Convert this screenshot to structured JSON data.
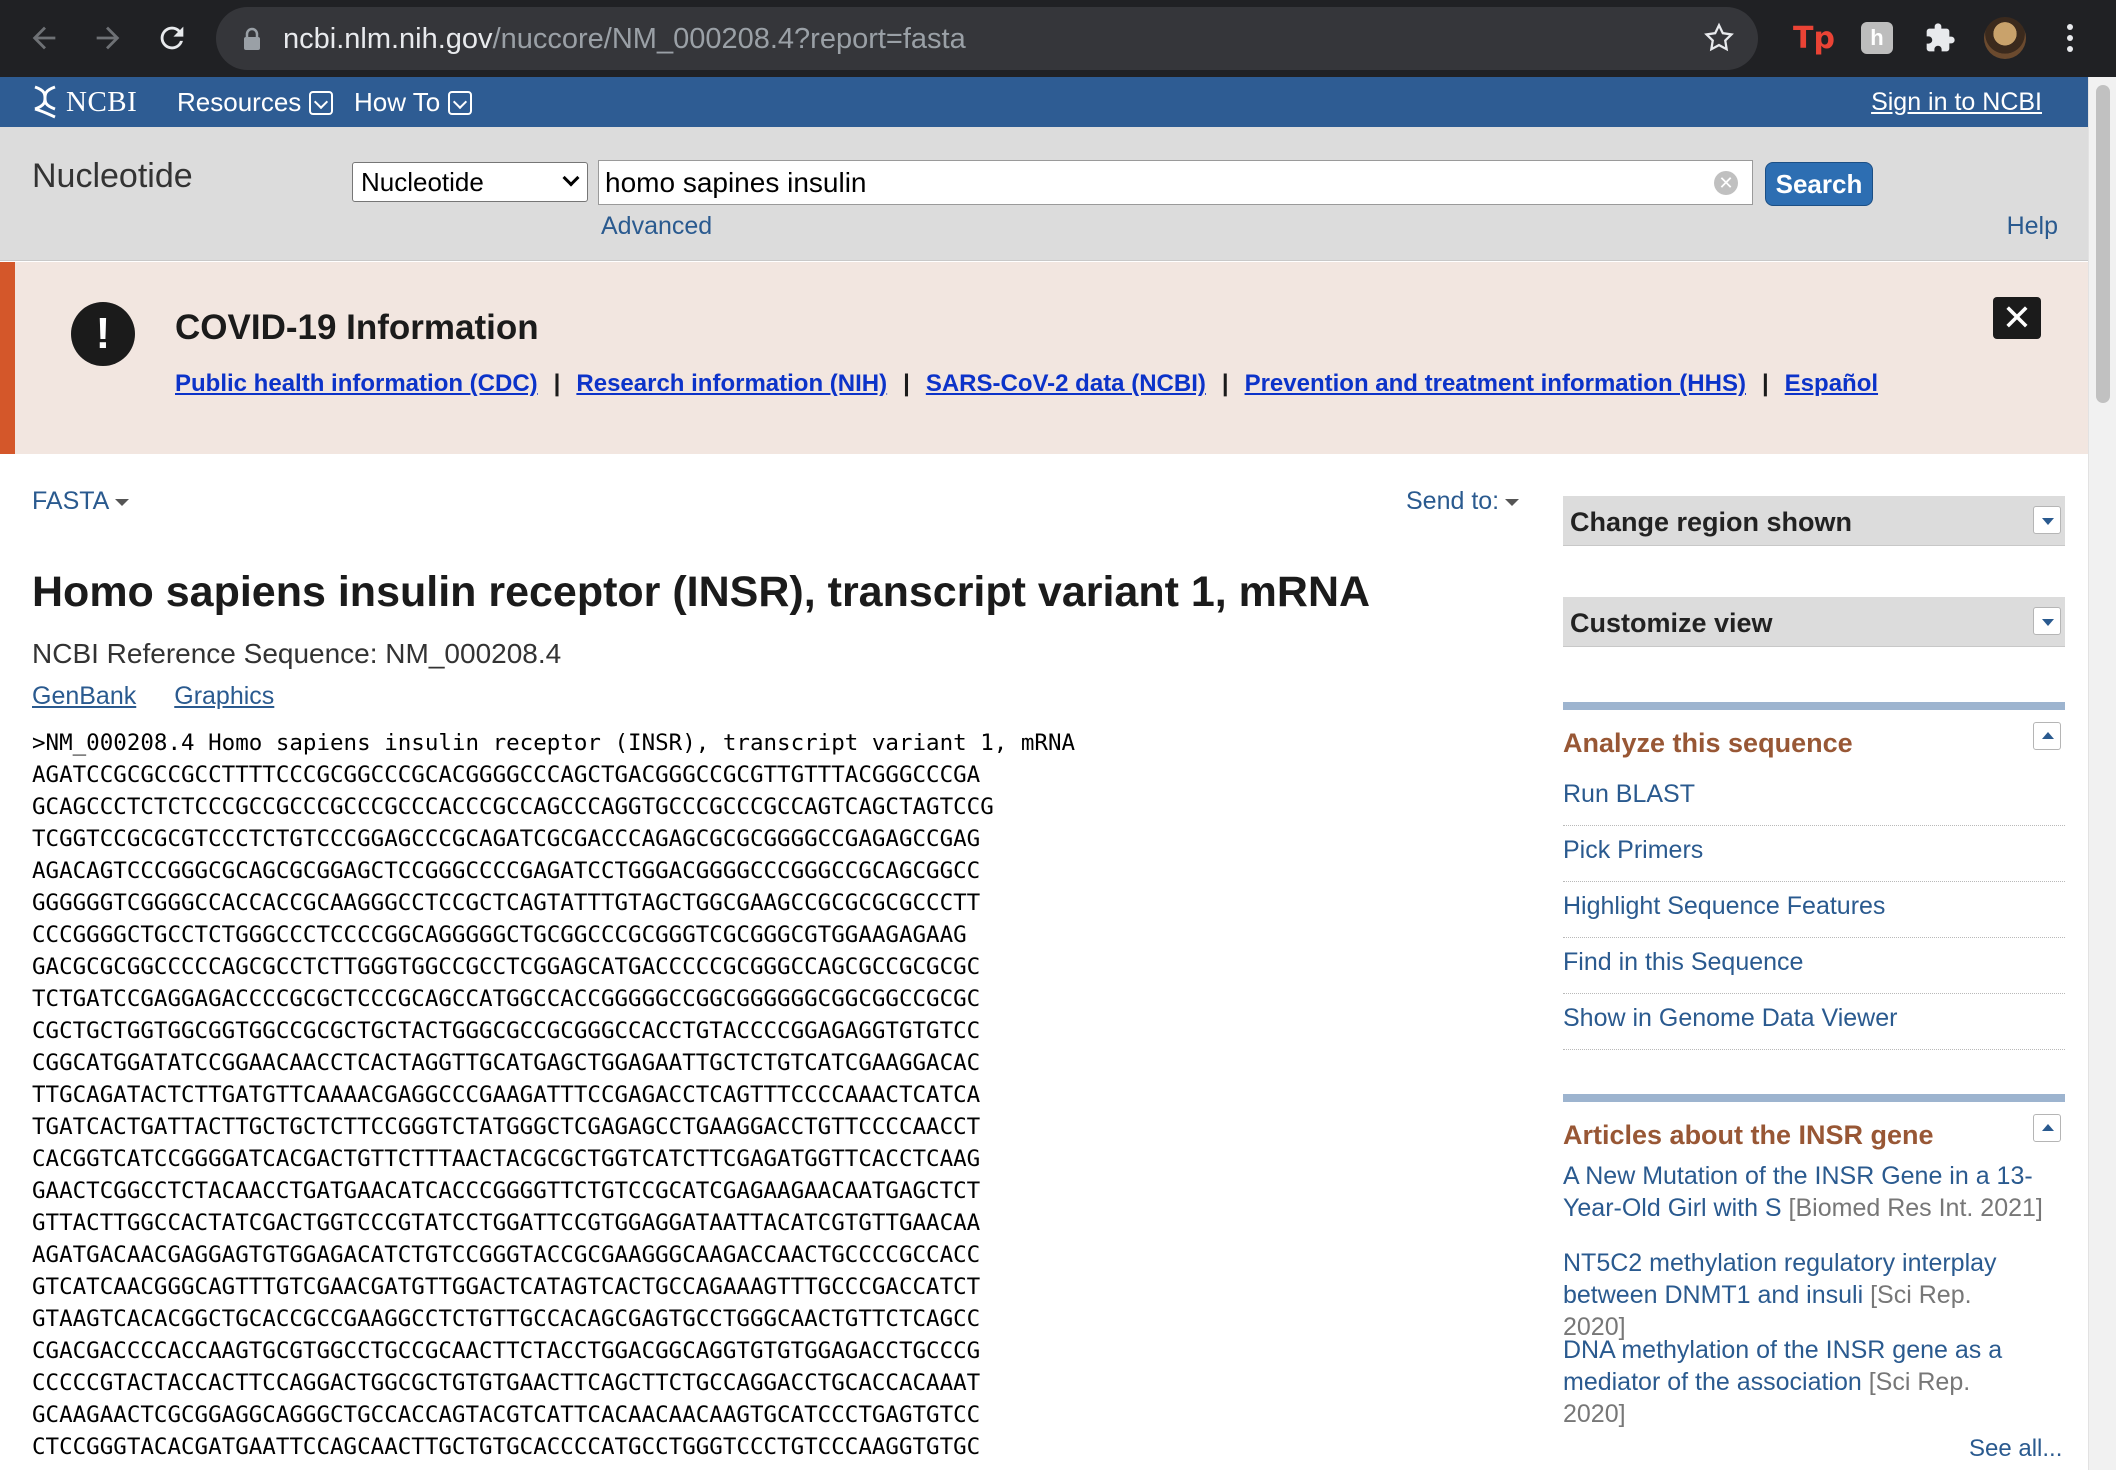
{
  "browser": {
    "url_host": "ncbi.nlm.nih.gov",
    "url_path": "/nuccore/NM_000208.4?report=fasta",
    "ext_tp_label": "Tp",
    "ext_gray_label": "h"
  },
  "ncbi_bar": {
    "logo_text": "NCBI",
    "resources_label": "Resources",
    "howto_label": "How To",
    "sign_in_label": "Sign in to NCBI"
  },
  "search": {
    "db_title": "Nucleotide",
    "db_selected": "Nucleotide",
    "query": "homo sapines insulin",
    "search_button": "Search",
    "advanced_link": "Advanced",
    "help_link": "Help"
  },
  "covid": {
    "title": "COVID-19 Information",
    "links": [
      "Public health information (CDC)",
      "Research information (NIH)",
      "SARS-CoV-2 data (NCBI)",
      "Prevention and treatment information (HHS)",
      "Español"
    ],
    "separator": "|"
  },
  "main": {
    "format_menu": "FASTA",
    "send_to": "Send to:",
    "title": "Homo sapiens insulin receptor (INSR), transcript variant 1, mRNA",
    "ref_seq": "NCBI Reference Sequence: NM_000208.4",
    "tabs": [
      "GenBank",
      "Graphics"
    ],
    "sequence_lines": [
      ">NM_000208.4 Homo sapiens insulin receptor (INSR), transcript variant 1, mRNA",
      "AGATCCGCGCCGCCTTTTCCCGCGGCCCGCACGGGGCCCAGCTGACGGGCCGCGTTGTTTACGGGCCCGA",
      "GCAGCCCTCTCTCCCGCCGCCCGCCCGCCCACCCGCCAGCCCAGGTGCCCGCCCGCCAGTCAGCTAGTCCG",
      "TCGGTCCGCGCGTCCCTCTGTCCCGGAGCCCGCAGATCGCGACCCAGAGCGCGCGGGGCCGAGAGCCGAG",
      "AGACAGTCCCGGGCGCAGCGCGGAGCTCCGGGCCCCGAGATCCTGGGACGGGGCCCGGGCCGCAGCGGCC",
      "GGGGGGTCGGGGCCACCACCGCAAGGGCCTCCGCTCAGTATTTGTAGCTGGCGAAGCCGCGCGCGCCCTT",
      "CCCGGGGCTGCCTCTGGGCCCTCCCCGGCAGGGGGCTGCGGCCCGCGGGTCGCGGGCGTGGAAGAGAAG",
      "GACGCGCGGCCCCCAGCGCCTCTTGGGTGGCCGCCTCGGAGCATGACCCCCGCGGGCCAGCGCCGCGCGC",
      "TCTGATCCGAGGAGACCCCGCGCTCCCGCAGCCATGGCCACCGGGGGCCGGCGGGGGGCGGCGGCCGCGC",
      "CGCTGCTGGTGGCGGTGGCCGCGCTGCTACTGGGCGCCGCGGGCCACCTGTACCCCGGAGAGGTGTGTCC",
      "CGGCATGGATATCCGGAACAACCTCACTAGGTTGCATGAGCTGGAGAATTGCTCTGTCATCGAAGGACAC",
      "TTGCAGATACTCTTGATGTTCAAAACGAGGCCCGAAGATTTCCGAGACCTCAGTTTCCCCAAACTCATCA",
      "TGATCACTGATTACTTGCTGCTCTTCCGGGTCTATGGGCTCGAGAGCCTGAAGGACCTGTTCCCCAACCT",
      "CACGGTCATCCGGGGATCACGACTGTTCTTTAACTACGCGCTGGTCATCTTCGAGATGGTTCACCTCAAG",
      "GAACTCGGCCTCTACAACCTGATGAACATCACCCGGGGTTCTGTCCGCATCGAGAAGAACAATGAGCTCT",
      "GTTACTTGGCCACTATCGACTGGTCCCGTATCCTGGATTCCGTGGAGGATAATTACATCGTGTTGAACAA",
      "AGATGACAACGAGGAGTGTGGAGACATCTGTCCGGGTACCGCGAAGGGCAAGACCAACTGCCCCGCCACC",
      "GTCATCAACGGGCAGTTTGTCGAACGATGTTGGACTCATAGTCACTGCCAGAAAGTTTGCCCGACCATCT",
      "GTAAGTCACACGGCTGCACCGCCGAAGGCCTCTGTTGCCACAGCGAGTGCCTGGGCAACTGTTCTCAGCC",
      "CGACGACCCCACCAAGTGCGTGGCCTGCCGCAACTTCTACCTGGACGGCAGGTGTGTGGAGACCTGCCCG",
      "CCCCCGTACTACCACTTCCAGGACTGGCGCTGTGTGAACTTCAGCTTCTGCCAGGACCTGCACCACAAAT",
      "GCAAGAACTCGCGGAGGCAGGGCTGCCACCAGTACGTCATTCACAACAACAAGTGCATCCCTGAGTGTCC",
      "CTCCGGGTACACGATGAATTCCAGCAACTTGCTGTGCACCCCATGCCTGGGTCCCTGTCCCAAGGTGTGC"
    ]
  },
  "sidebar": {
    "change_region": "Change region shown",
    "customize_view": "Customize view",
    "analyze_title": "Analyze this sequence",
    "analyze_items": [
      "Run BLAST",
      "Pick Primers",
      "Highlight Sequence Features",
      "Find in this Sequence",
      "Show in Genome Data Viewer"
    ],
    "articles_title": "Articles about the INSR gene",
    "articles": [
      {
        "title": "A New Mutation of the INSR Gene in a 13-Year-Old Girl with S",
        "source": "[Biomed Res Int. 2021]"
      },
      {
        "title": "NT5C2 methylation regulatory interplay between DNMT1 and insuli",
        "source": "[Sci Rep. 2020]"
      },
      {
        "title": "DNA methylation of the INSR gene as a mediator of the association",
        "source": "[Sci Rep. 2020]"
      }
    ],
    "see_all": "See all..."
  }
}
